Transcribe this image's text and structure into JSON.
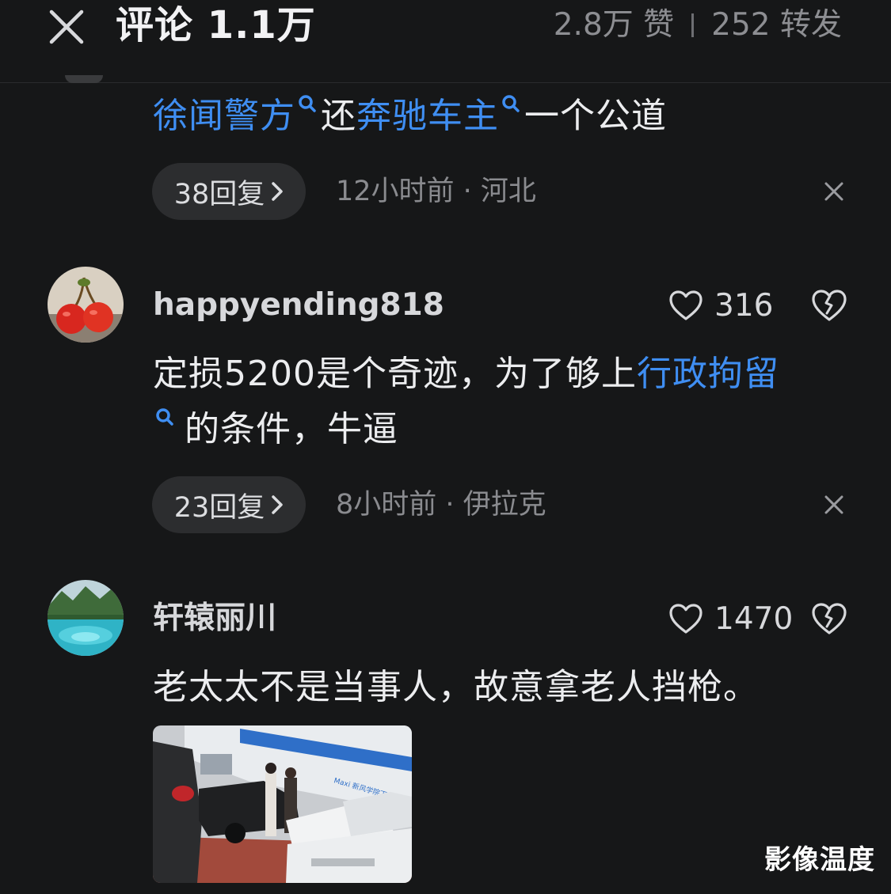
{
  "header": {
    "title": "评论 1.1万",
    "likes": "2.8万 赞",
    "shares": "252 转发"
  },
  "comments": [
    {
      "text_parts": [
        {
          "text": "徐闻警方",
          "link": true
        },
        {
          "text": "还",
          "link": false
        },
        {
          "text": "奔驰车主",
          "link": true
        },
        {
          "text": "一个公道",
          "link": false
        }
      ],
      "reply_label": "38回复",
      "meta": "12小时前 · 河北"
    },
    {
      "username": "happyending818",
      "likes": "316",
      "text_parts": [
        {
          "text": "定损5200是个奇迹，为了够上",
          "link": false
        },
        {
          "text": "行政拘留",
          "link": true
        },
        {
          "text": "的条件，牛逼",
          "link": false
        }
      ],
      "reply_label": "23回复",
      "meta": "8小时前 · 伊拉克"
    },
    {
      "username": "轩辕丽川",
      "likes": "1470",
      "text": "老太太不是当事人，故意拿老人挡枪。",
      "photo_caption": "Maxi 新风学院下 →"
    }
  ],
  "watermark": "影像温度",
  "icons": {
    "close": "close-icon",
    "search": "search-icon",
    "chevron": "chevron-right-icon",
    "dismiss": "close-icon",
    "heart": "heart-icon",
    "broken_heart": "broken-heart-icon"
  },
  "colors": {
    "background": "#161718",
    "link": "#3f8ef2",
    "pill": "#2c2d2f",
    "muted": "#8a8b8f"
  }
}
